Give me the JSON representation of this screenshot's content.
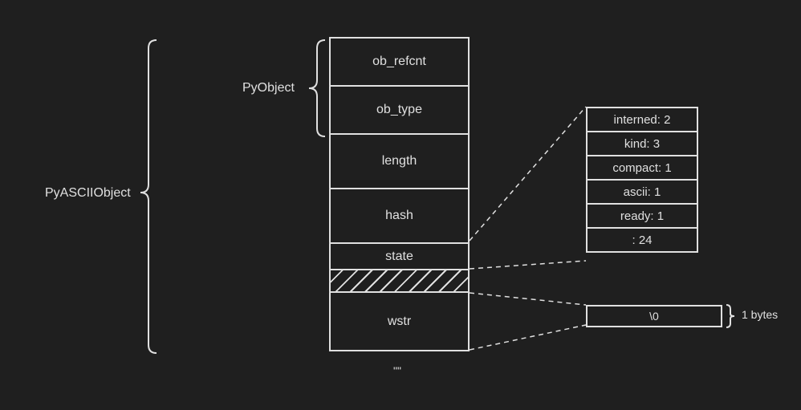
{
  "labels": {
    "outer": "PyASCIIObject",
    "inner": "PyObject",
    "bytes_note": "1 bytes",
    "caption": "\"\""
  },
  "main_fields": [
    "ob_refcnt",
    "ob_type",
    "length",
    "hash",
    "state",
    "",
    "wstr"
  ],
  "state_fields": [
    "interned: 2",
    "kind: 3",
    "compact: 1",
    "ascii: 1",
    "ready: 1",
    ": 24"
  ],
  "wstr_content": "\\0"
}
